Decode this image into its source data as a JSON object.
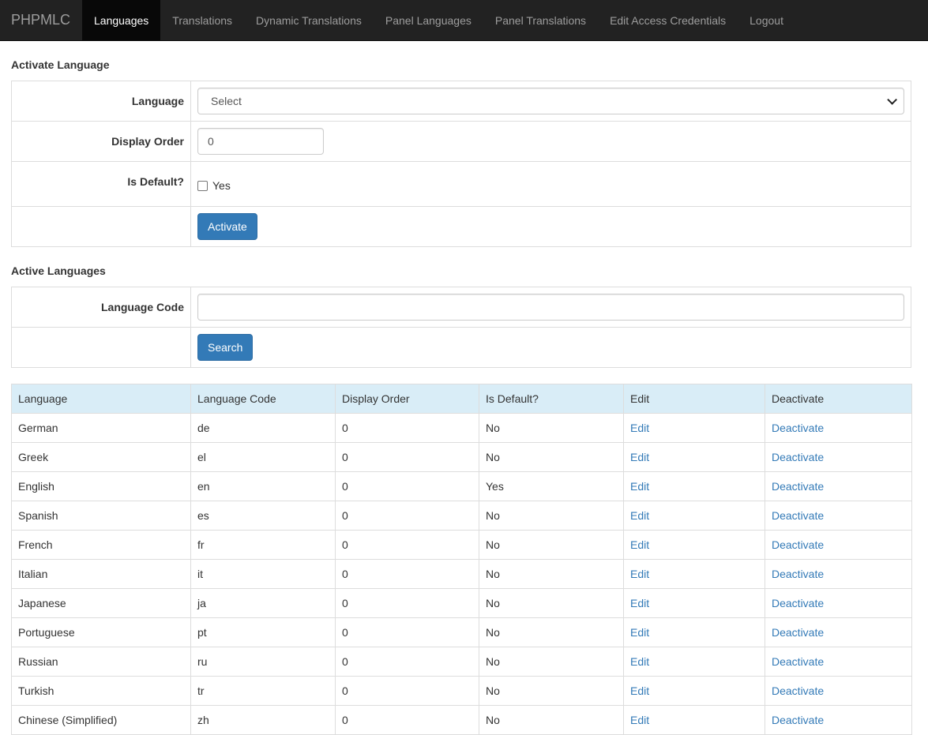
{
  "navbar": {
    "brand": "PHPMLC",
    "items": [
      {
        "label": "Languages",
        "active": true
      },
      {
        "label": "Translations",
        "active": false
      },
      {
        "label": "Dynamic Translations",
        "active": false
      },
      {
        "label": "Panel Languages",
        "active": false
      },
      {
        "label": "Panel Translations",
        "active": false
      },
      {
        "label": "Edit Access Credentials",
        "active": false
      },
      {
        "label": "Logout",
        "active": false
      }
    ]
  },
  "activate": {
    "heading": "Activate Language",
    "language_label": "Language",
    "language_value": "Select",
    "display_order_label": "Display Order",
    "display_order_value": "0",
    "is_default_label": "Is Default?",
    "is_default_option": "Yes",
    "is_default_checked": false,
    "submit_label": "Activate"
  },
  "active": {
    "heading": "Active Languages",
    "code_label": "Language Code",
    "code_value": "",
    "search_label": "Search"
  },
  "table": {
    "columns": [
      "Language",
      "Language Code",
      "Display Order",
      "Is Default?",
      "Edit",
      "Deactivate"
    ],
    "rows": [
      {
        "language": "German",
        "code": "de",
        "order": "0",
        "is_default": "No",
        "edit": "Edit",
        "deactivate": "Deactivate"
      },
      {
        "language": "Greek",
        "code": "el",
        "order": "0",
        "is_default": "No",
        "edit": "Edit",
        "deactivate": "Deactivate"
      },
      {
        "language": "English",
        "code": "en",
        "order": "0",
        "is_default": "Yes",
        "edit": "Edit",
        "deactivate": "Deactivate"
      },
      {
        "language": "Spanish",
        "code": "es",
        "order": "0",
        "is_default": "No",
        "edit": "Edit",
        "deactivate": "Deactivate"
      },
      {
        "language": "French",
        "code": "fr",
        "order": "0",
        "is_default": "No",
        "edit": "Edit",
        "deactivate": "Deactivate"
      },
      {
        "language": "Italian",
        "code": "it",
        "order": "0",
        "is_default": "No",
        "edit": "Edit",
        "deactivate": "Deactivate"
      },
      {
        "language": "Japanese",
        "code": "ja",
        "order": "0",
        "is_default": "No",
        "edit": "Edit",
        "deactivate": "Deactivate"
      },
      {
        "language": "Portuguese",
        "code": "pt",
        "order": "0",
        "is_default": "No",
        "edit": "Edit",
        "deactivate": "Deactivate"
      },
      {
        "language": "Russian",
        "code": "ru",
        "order": "0",
        "is_default": "No",
        "edit": "Edit",
        "deactivate": "Deactivate"
      },
      {
        "language": "Turkish",
        "code": "tr",
        "order": "0",
        "is_default": "No",
        "edit": "Edit",
        "deactivate": "Deactivate"
      },
      {
        "language": "Chinese (Simplified)",
        "code": "zh",
        "order": "0",
        "is_default": "No",
        "edit": "Edit",
        "deactivate": "Deactivate"
      }
    ]
  },
  "colors": {
    "navbar_bg": "#222222",
    "nav_active_bg": "#080808",
    "primary": "#337ab7",
    "table_header_bg": "#d9edf7",
    "border": "#dddddd"
  }
}
